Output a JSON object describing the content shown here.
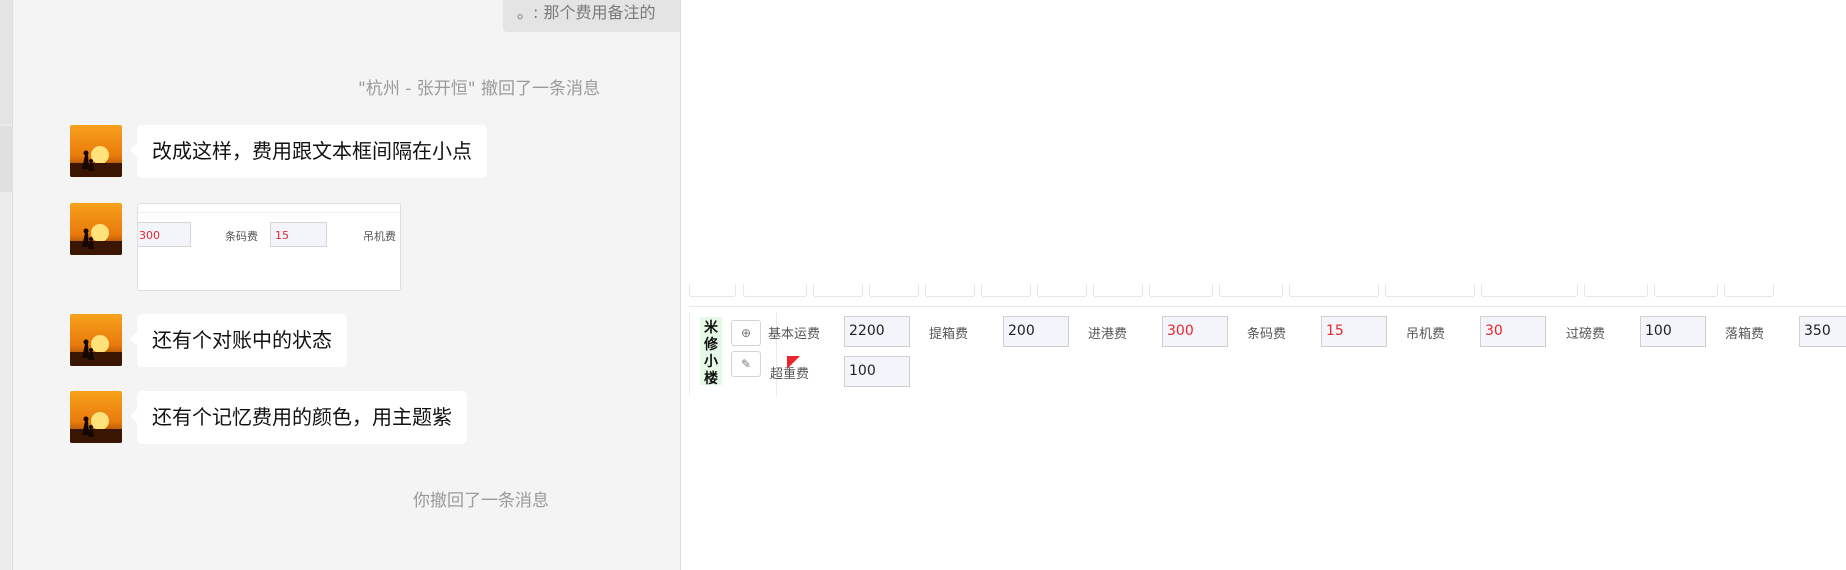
{
  "chat": {
    "quoted_text": "。: 那个费用备注的",
    "recall_notice_1": "\"杭州 - 张开恒\" 撤回了一条消息",
    "messages": [
      {
        "text": "改成这样，费用跟文本框间隔在小点"
      },
      {
        "text": "还有个对账中的状态"
      },
      {
        "text": "还有个记忆费用的颜色，用主题紫"
      }
    ],
    "image_preview": {
      "values": [
        "300",
        "15"
      ],
      "labels": [
        "条码费",
        "吊机费"
      ]
    },
    "recall_notice_2": "你撤回了一条消息"
  },
  "panel": {
    "row_name": "米修小楼",
    "add_icon": "⊕",
    "edit_icon": "✎",
    "fields": [
      {
        "label": "基本运费",
        "value": "2200",
        "color": "#222222"
      },
      {
        "label": "提箱费",
        "value": "200",
        "color": "#222222"
      },
      {
        "label": "进港费",
        "value": "300",
        "color": "#e8262c"
      },
      {
        "label": "条码费",
        "value": "15",
        "color": "#e8262c"
      },
      {
        "label": "吊机费",
        "value": "30",
        "color": "#e8262c"
      },
      {
        "label": "过磅费",
        "value": "100",
        "color": "#222222"
      },
      {
        "label": "落箱费",
        "value": "350",
        "color": "#222222"
      },
      {
        "label": "超重费",
        "value": "100",
        "color": "#222222"
      }
    ]
  }
}
